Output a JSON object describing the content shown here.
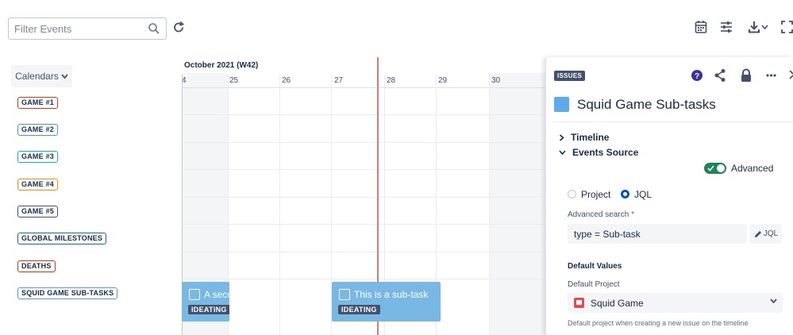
{
  "toolbar": {
    "filter_placeholder": "Filter Events",
    "icons": [
      "search-icon",
      "refresh-icon",
      "calendar-icon",
      "sliders-icon",
      "download-icon",
      "chevron-down-icon",
      "fullscreen-icon"
    ]
  },
  "sidebar": {
    "calendars_label": "Calendars",
    "calendars": [
      {
        "label": "GAME #1",
        "color": "#de350b"
      },
      {
        "label": "GAME #2",
        "color": "#36b37e"
      },
      {
        "label": "GAME #3",
        "color": "#00b8d9"
      },
      {
        "label": "GAME #4",
        "color": "#ff8b00"
      },
      {
        "label": "GAME #5",
        "color": "#42526e"
      },
      {
        "label": "GLOBAL MILESTONES",
        "color": "#00875a"
      },
      {
        "label": "DEATHS",
        "color": "#de350b"
      },
      {
        "label": "SQUID GAME SUB-TASKS",
        "color": "#4c9aff"
      }
    ]
  },
  "timeline": {
    "month_label": "October 2021 (W42)",
    "days": [
      "4",
      "25",
      "26",
      "27",
      "28",
      "29",
      "30"
    ],
    "events": [
      {
        "title": "A secc",
        "status": "IDEATING"
      },
      {
        "title": "This is a sub-task",
        "status": "IDEATING"
      }
    ]
  },
  "panel": {
    "badge": "ISSUES",
    "icons": [
      "help-icon",
      "share-icon",
      "lock-icon",
      "more-icon",
      "close-icon"
    ],
    "title": "Squid Game Sub-tasks",
    "swatch_color": "#5cace8",
    "sections": {
      "timeline": "Timeline",
      "events_source": "Events Source"
    },
    "advanced_label": "Advanced",
    "radio_project": "Project",
    "radio_jql": "JQL",
    "advanced_search_label": "Advanced search",
    "required_mark": "*",
    "jql_value": "type = Sub-task",
    "jql_button": "JQL",
    "default_values_title": "Default Values",
    "default_project_label": "Default Project",
    "default_project_value": "Squid Game",
    "default_project_hint": "Default project when creating a new issue on the timeline"
  }
}
